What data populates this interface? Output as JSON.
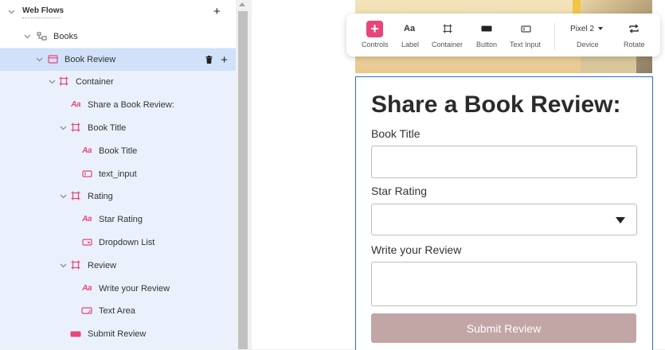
{
  "tree": {
    "root": {
      "label": "Web Flows",
      "add_icon": "plus-icon"
    },
    "items": [
      {
        "label": "Books",
        "icon": "flow-icon"
      },
      {
        "label": "Book Review",
        "icon": "page-icon"
      },
      {
        "label": "Container",
        "icon": "container-icon"
      },
      {
        "label": "Share a Book Review:",
        "icon": "text-icon"
      },
      {
        "label": "Book Title",
        "icon": "container-icon"
      },
      {
        "label": "Book Title",
        "icon": "text-icon"
      },
      {
        "label": "text_input",
        "icon": "text-input-icon"
      },
      {
        "label": "Rating",
        "icon": "container-icon"
      },
      {
        "label": "Star Rating",
        "icon": "text-icon"
      },
      {
        "label": "Dropdown List",
        "icon": "dropdown-icon"
      },
      {
        "label": "Review",
        "icon": "container-icon"
      },
      {
        "label": "Write your Review",
        "icon": "text-icon"
      },
      {
        "label": "Text Area",
        "icon": "textarea-icon"
      },
      {
        "label": "Submit Review",
        "icon": "button-icon"
      }
    ],
    "text_glyph": "Aa",
    "selected_actions": {
      "delete": "trash-icon",
      "add": "plus-icon"
    }
  },
  "toolbar": {
    "controls": "Controls",
    "label": "Label",
    "label_glyph": "Aa",
    "container": "Container",
    "button": "Button",
    "text_input": "Text Input",
    "device_value": "Pixel 2",
    "device": "Device",
    "rotate": "Rotate"
  },
  "form": {
    "heading": "Share a Book Review:",
    "book_title_label": "Book Title",
    "book_title_value": "",
    "star_rating_label": "Star Rating",
    "star_rating_value": "",
    "review_label": "Write your Review",
    "review_value": "",
    "submit_label": "Submit Review"
  },
  "colors": {
    "accent": "#e8457b",
    "selection": "#d1e1f9",
    "tree_bg": "#eaf1fc",
    "submit_bg": "#c2a5a5",
    "card_border": "#2e6fd0"
  }
}
